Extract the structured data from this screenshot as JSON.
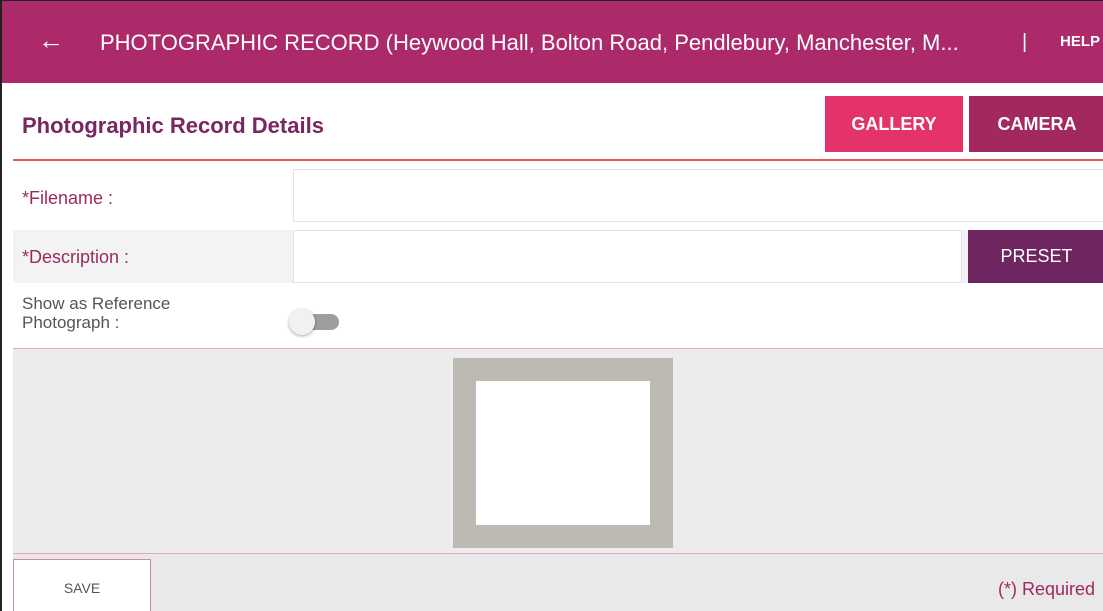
{
  "appbar": {
    "title": "PHOTOGRAPHIC RECORD (Heywood Hall, Bolton Road, Pendlebury, Manchester, M...",
    "separator": "|",
    "help_label": "HELP",
    "back_icon": "arrow-left-icon",
    "color": "#ac2a6a"
  },
  "section": {
    "title": "Photographic Record Details",
    "gallery_label": "GALLERY",
    "camera_label": "CAMERA"
  },
  "form": {
    "filename_label": "*Filename :",
    "filename_value": "",
    "description_label": "*Description :",
    "description_value": "",
    "preset_label": "PRESET",
    "reference_label_line1": "Show as Reference",
    "reference_label_line2": "Photograph :",
    "reference_toggle_on": false
  },
  "footer": {
    "save_label": "SAVE",
    "required_note": "(*) Required"
  },
  "colors": {
    "gallery": "#e4336a",
    "camera": "#a3285f",
    "preset": "#6f2560",
    "accent_rule": "#e05a5a"
  }
}
